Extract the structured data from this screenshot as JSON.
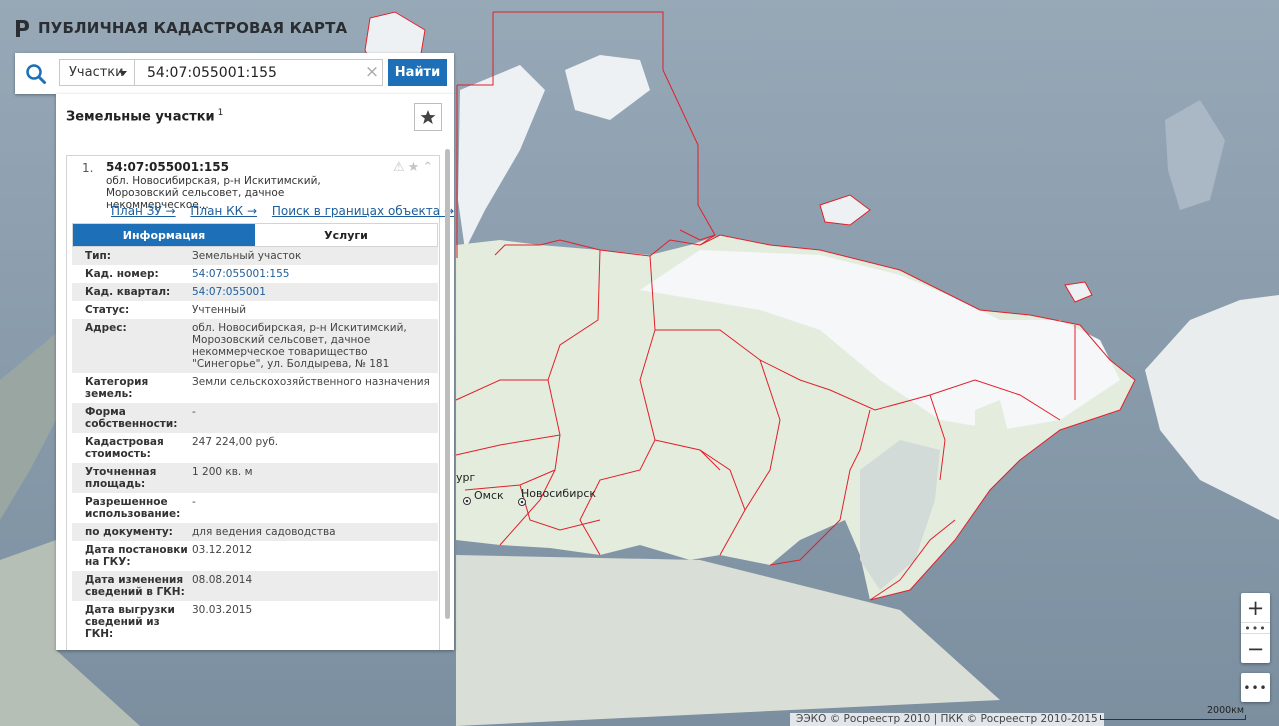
{
  "app": {
    "title": "ПУБЛИЧНАЯ КАДАСТРОВАЯ КАРТА",
    "logo_icon": "pkk-logo-icon"
  },
  "search": {
    "type_label": "Участки",
    "query": "54:07:055001:155",
    "clear_label": "×",
    "button_label": "Найти",
    "icon": "search-icon"
  },
  "results": {
    "title": "Земельные участки",
    "count": "1",
    "items": [
      {
        "number": "1.",
        "cad_number": "54:07:055001:155",
        "address_short": "обл. Новосибирская, р-н Искитимский, Морозовский сельсовет, дачное некоммерческое...",
        "links": [
          "План ЗУ →",
          "План КК →",
          "Поиск в границах объекта →"
        ],
        "tabs": [
          {
            "label": "Информация",
            "active": true
          },
          {
            "label": "Услуги",
            "active": false
          }
        ],
        "info": [
          {
            "label": "Тип:",
            "value": "Земельный участок"
          },
          {
            "label": "Кад. номер:",
            "value": "54:07:055001:155",
            "link": true
          },
          {
            "label": "Кад. квартал:",
            "value": "54:07:055001",
            "link": true
          },
          {
            "label": "Статус:",
            "value": "Учтенный"
          },
          {
            "label": "Адрес:",
            "value": "обл. Новосибирская, р-н Искитимский, Морозовский сельсовет, дачное некоммерческое товарищество \"Синегорье\", ул. Болдырева, № 181"
          },
          {
            "label": "Категория земель:",
            "value": "Земли сельскохозяйственного назначения"
          },
          {
            "label": "Форма собственности:",
            "value": "-"
          },
          {
            "label": "Кадастровая стоимость:",
            "value": "247 224,00 руб."
          },
          {
            "label": "Уточненная площадь:",
            "value": "1 200 кв. м"
          },
          {
            "label": "Разрешенное использование:",
            "value": "-"
          },
          {
            "label": "по документу:",
            "value": "для ведения садоводства"
          },
          {
            "label": "Дата постановки на ГКУ:",
            "value": "03.12.2012"
          },
          {
            "label": "Дата изменения сведений в ГКН:",
            "value": "08.08.2014"
          },
          {
            "label": "Дата выгрузки сведений из ГКН:",
            "value": "30.03.2015"
          }
        ]
      }
    ]
  },
  "map": {
    "cities": [
      "Омск",
      "Новосибирск"
    ],
    "partial_label": "ург",
    "scale": "2000км",
    "attribution": "ЭЭКО © Росреестр 2010 | ПКК © Росреестр 2010-2015",
    "colors": {
      "ocean": "#8fa2b2",
      "land": "#e4ecde",
      "snow": "#f5f7f8",
      "boundary": "#e0202a",
      "accent": "#1d6fb8"
    }
  },
  "controls": {
    "zoom_in": "+",
    "zoom_out": "−",
    "dots": "•••",
    "more": "•••"
  }
}
